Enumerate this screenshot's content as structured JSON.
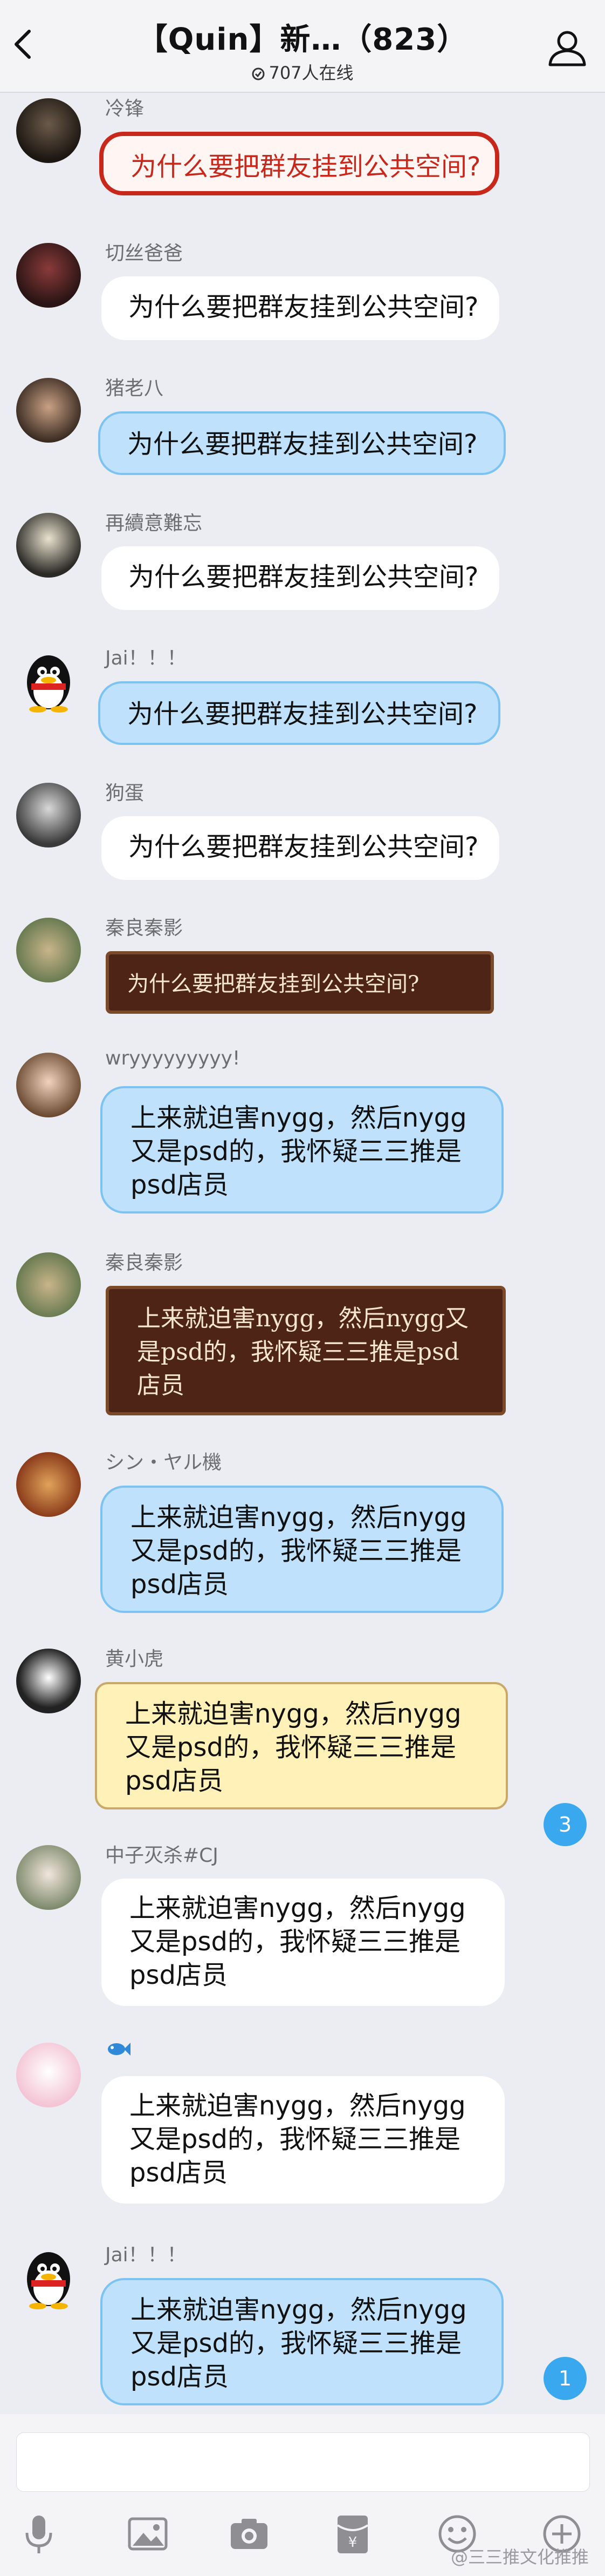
{
  "header": {
    "title": "【Quin】新…（823）",
    "online_count": "707人在线"
  },
  "messages": [
    {
      "name": "冷锋",
      "text": "为什么要把群友挂到公共空间?",
      "style": "red"
    },
    {
      "name": "切丝爸爸",
      "text": "为什么要把群友挂到公共空间?",
      "style": "white"
    },
    {
      "name": "猪老八",
      "text": "为什么要把群友挂到公共空间?",
      "style": "blue"
    },
    {
      "name": "再續意難忘",
      "text": "为什么要把群友挂到公共空间?",
      "style": "white"
    },
    {
      "name": "Jai！！！",
      "text": "为什么要把群友挂到公共空间?",
      "style": "blue"
    },
    {
      "name": "狗蛋",
      "text": "为什么要把群友挂到公共空间?",
      "style": "white"
    },
    {
      "name": "秦良秦影",
      "text": "为什么要把群友挂到公共空间?",
      "style": "wood"
    },
    {
      "name": "wryyyyyyyyy!",
      "text": "上来就迫害nygg，然后nygg又是psd的，我怀疑三三推是psd店员",
      "style": "blue"
    },
    {
      "name": "秦良秦影",
      "text": "上来就迫害nygg，然后nygg又是psd的，我怀疑三三推是psd店员",
      "style": "wood"
    },
    {
      "name": "シン・ヤル機",
      "text": "上来就迫害nygg，然后nygg又是psd的，我怀疑三三推是psd店员",
      "style": "blue"
    },
    {
      "name": "黄小虎",
      "text": "上来就迫害nygg，然后nygg又是psd的，我怀疑三三推是psd店员",
      "style": "yellow"
    },
    {
      "name": "中子灭杀#CJ",
      "text": "上来就迫害nygg，然后nygg又是psd的，我怀疑三三推是psd店员",
      "style": "white"
    },
    {
      "name": "",
      "text": "上来就迫害nygg，然后nygg又是psd的，我怀疑三三推是psd店员",
      "style": "white"
    },
    {
      "name": "Jai！！！",
      "text": "上来就迫害nygg，然后nygg又是psd的，我怀疑三三推是psd店员",
      "style": "blue"
    }
  ],
  "badges": {
    "unread_top": "3",
    "unread_bottom": "1"
  },
  "input": {
    "placeholder": ""
  },
  "toolbar": [
    "mic-icon",
    "image-icon",
    "camera-icon",
    "red-packet-icon",
    "emoji-icon",
    "plus-icon"
  ],
  "watermark": "@三三推文化推推",
  "colors": {
    "bubble_blue": "#bfe1fb",
    "bubble_red_border": "#c8281b",
    "bubble_wood": "#4d2416",
    "bubble_yellow": "#fff1b8",
    "badge": "#3aa8ef"
  }
}
